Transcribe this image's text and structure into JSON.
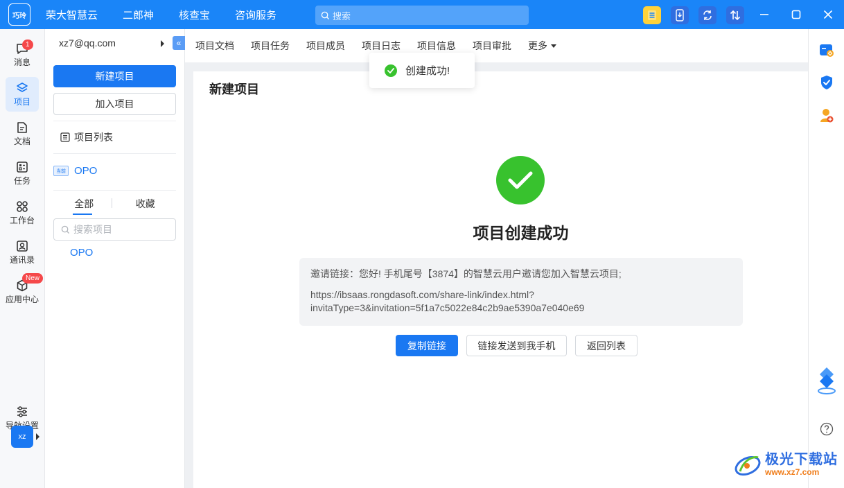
{
  "app": {
    "logo_text": "巧玲",
    "nav": [
      "荣大智慧云",
      "二郎神",
      "核查宝",
      "咨询服务"
    ],
    "search_placeholder": "搜索"
  },
  "rail": {
    "items": [
      {
        "label": "消息",
        "icon": "message-icon",
        "badge": "1"
      },
      {
        "label": "项目",
        "icon": "project-icon",
        "active": true
      },
      {
        "label": "文档",
        "icon": "document-icon"
      },
      {
        "label": "任务",
        "icon": "task-icon"
      },
      {
        "label": "工作台",
        "icon": "workbench-icon"
      },
      {
        "label": "通讯录",
        "icon": "contacts-icon"
      },
      {
        "label": "应用中心",
        "icon": "app-center-icon",
        "badge": "New"
      }
    ],
    "nav_settings": "导航设置",
    "avatar": "xz"
  },
  "projbar": {
    "email": "xz7@qq.com",
    "collapse_icon": "«",
    "new_project": "新建项目",
    "join_project": "加入项目",
    "project_list": "项目列表",
    "current_tag": "当前",
    "current_project": "OPO",
    "tabs": [
      "全部",
      "收藏"
    ],
    "search_placeholder": "搜索项目",
    "projects": [
      "OPO"
    ]
  },
  "main": {
    "tabs": [
      "项目文档",
      "项目任务",
      "项目成员",
      "项目日志",
      "项目信息",
      "项目审批",
      "更多"
    ],
    "card_title": "新建项目",
    "success_title": "项目创建成功",
    "invite_text": "邀请链接：您好! 手机尾号【3874】的智慧云用户邀请您加入智慧云项目;",
    "invite_link_1": "https://ibsaas.rongdasoft.com/share-link/index.html?",
    "invite_link_2": "invitaType=3&invitation=5f1a7c5022e84c2b9ae5390a7e040e69",
    "btn_copy": "复制链接",
    "btn_send": "链接发送到我手机",
    "btn_back": "返回列表"
  },
  "toast": {
    "text": "创建成功!"
  },
  "watermark": {
    "title": "极光下载站",
    "url": "www.xz7.com"
  },
  "colors": {
    "primary": "#1a78f2",
    "topbar": "#1a85f8",
    "success": "#38c22e",
    "badge": "#f5484a"
  }
}
